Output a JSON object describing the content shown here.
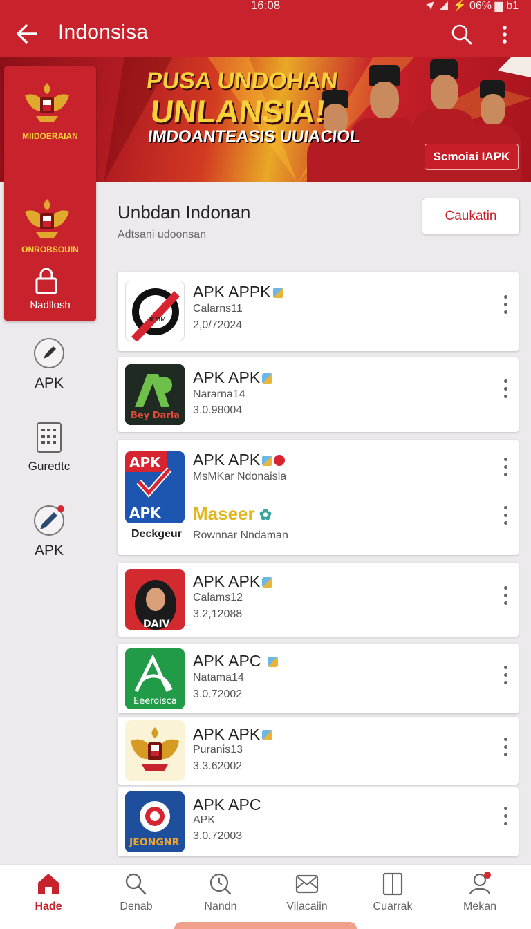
{
  "status_bar": {
    "time": "16:08",
    "battery": "⚡ 06% ▆ b1"
  },
  "app_bar": {
    "title": "Indonsisa"
  },
  "banner": {
    "line1": "PUSA UNDOHAN",
    "line2": "UNLANSIA!",
    "line3": "IMDOANTEASIS UUIACIOL",
    "cta": "Scmoiai IAPK"
  },
  "sidebar": {
    "emblem1_caption": "MIIDOERAIAN",
    "emblem2_caption": "ONROBSOUIN",
    "lock_label": "Nadllosh",
    "items": [
      {
        "label": "APK",
        "icon": "pen-circle-icon"
      },
      {
        "label": "Guredtc",
        "icon": "keypad-icon"
      },
      {
        "label": "APK",
        "icon": "pencil-circle-icon"
      }
    ]
  },
  "section": {
    "title": "Unbdan Indonan",
    "subtitle": "Adtsani udoonsan",
    "button": "Caukatin"
  },
  "apps": [
    {
      "title": "APK APPK",
      "line1": "Calarns11",
      "line2": "2,0/72024",
      "thumb_text": "IEMM"
    },
    {
      "title": "APK APK",
      "line1": "Nararna14",
      "line2": "3.0.98004",
      "thumb_text": "Bey Darla"
    },
    {
      "title": "APK APK",
      "line1": "MsMKar Ndonaisla",
      "thumb_top": "APK",
      "thumb_bottom": "APK",
      "caption": "Deckgeur",
      "brand": "Maseer",
      "line2": "Rownnar Nndaman"
    },
    {
      "title": "APK APK",
      "line1": "Calams12",
      "line2": "3.2,12088",
      "thumb_text": "DAIV"
    },
    {
      "title": "APK APC",
      "line1": "Natama14",
      "line2": "3.0.72002",
      "thumb_text": "Eeeroisca"
    },
    {
      "title": "APK APK",
      "line1": "Puranis13",
      "line2": "3.3.62002"
    },
    {
      "title": "APK APC",
      "line1": "APK",
      "line2": "3.0.72003",
      "thumb_text": "JEONGNR"
    }
  ],
  "bottom_nav": [
    {
      "label": "Hade",
      "icon": "home-icon",
      "active": true
    },
    {
      "label": "Denab",
      "icon": "search-icon",
      "active": false
    },
    {
      "label": "Nandn",
      "icon": "clock-search-icon",
      "active": false
    },
    {
      "label": "Vilacaiin",
      "icon": "mail-icon",
      "active": false
    },
    {
      "label": "Cuarrak",
      "icon": "book-icon",
      "active": false
    },
    {
      "label": "Mekan",
      "icon": "profile-icon",
      "active": false
    }
  ],
  "colors": {
    "brand": "#c8232d",
    "gold": "#f7d23c"
  }
}
